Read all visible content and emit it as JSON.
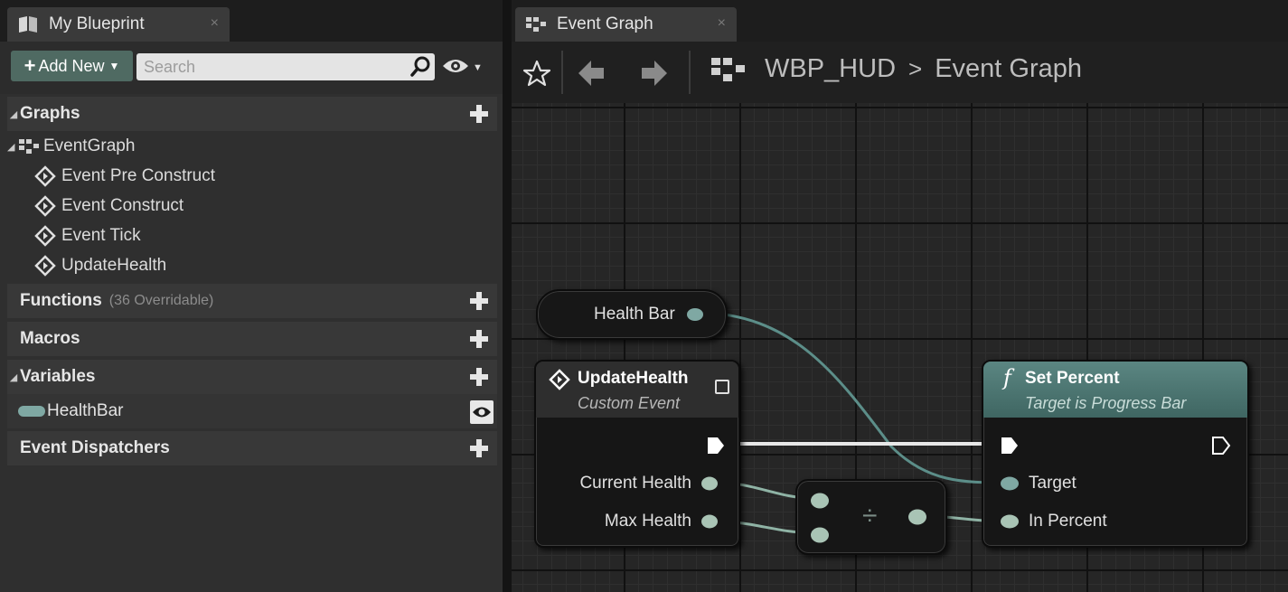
{
  "left_panel": {
    "tab_title": "My Blueprint",
    "tab_close": "×",
    "toolbar": {
      "add_new_label": "Add New",
      "search_placeholder": "Search"
    },
    "categories": {
      "graphs": {
        "label": "Graphs",
        "expanded": true
      },
      "functions": {
        "label": "Functions",
        "sub": "(36 Overridable)"
      },
      "macros": {
        "label": "Macros"
      },
      "variables": {
        "label": "Variables",
        "expanded": true
      },
      "event_dispatchers": {
        "label": "Event Dispatchers"
      }
    },
    "graph_tree": {
      "root": "EventGraph",
      "items": [
        "Event Pre Construct",
        "Event Construct",
        "Event Tick",
        "UpdateHealth"
      ]
    },
    "variables": [
      {
        "name": "HealthBar",
        "icon": "object-reference-pill",
        "color": "#7fa8a3"
      }
    ]
  },
  "graph_panel": {
    "tab_title": "Event Graph",
    "tab_close": "×",
    "breadcrumb": {
      "blueprint": "WBP_HUD",
      "separator": ">",
      "graph": "Event Graph"
    },
    "nodes": {
      "health_bar_getter": {
        "label": "Health Bar"
      },
      "update_health_event": {
        "title": "UpdateHealth",
        "subtitle": "Custom Event",
        "outputs": [
          "Current Health",
          "Max Health"
        ]
      },
      "divide": {
        "symbol": "÷"
      },
      "set_percent": {
        "title": "Set Percent",
        "subtitle": "Target is Progress Bar",
        "function_symbol": "f",
        "inputs": [
          "Target",
          "In Percent"
        ]
      }
    }
  },
  "colors": {
    "accent_button": "#4f6a62",
    "object_pin": "#7fa8a3",
    "float_pin": "#a9c4b5",
    "function_header": "#4a6f6b",
    "event_header": "#2e2e2e"
  }
}
